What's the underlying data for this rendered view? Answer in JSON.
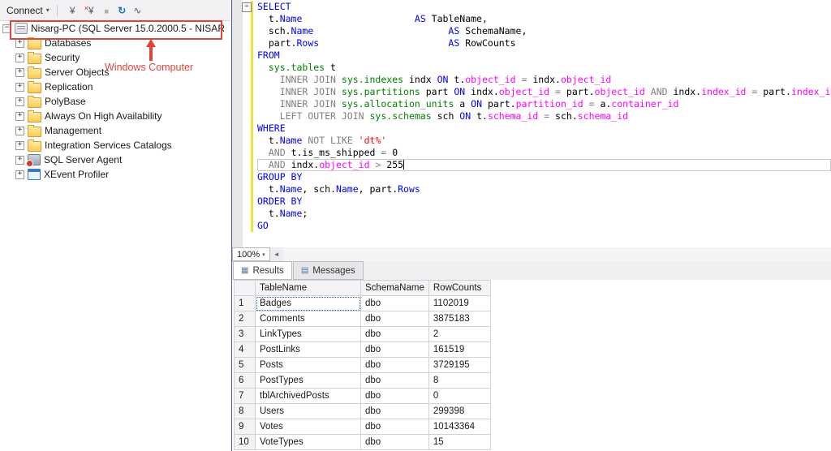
{
  "colors": {
    "keyword": "#0000ff",
    "operator": "#808080",
    "system_table": "#008000",
    "system_column": "#ff00ff",
    "string": "#ff0000",
    "text": "#000000",
    "annotation": "#e0443a",
    "refresh": "#1a73c9"
  },
  "object_explorer": {
    "toolbar": {
      "connect_label": "Connect",
      "icons": [
        {
          "name": "connect-icon",
          "glyph": "¥",
          "style": "connect"
        },
        {
          "name": "disconnect-icon",
          "glyph": "¥",
          "style": "disconnect"
        },
        {
          "name": "stop-icon",
          "glyph": "■",
          "style": "stop"
        },
        {
          "name": "refresh-icon",
          "glyph": "↻",
          "style": "refresh"
        },
        {
          "name": "activity-icon",
          "glyph": "∿",
          "style": "wave"
        }
      ]
    },
    "root_label": "Nisarg-PC (SQL Server 15.0.2000.5 - NISAR",
    "items": [
      {
        "label": "Databases",
        "icon": "folder"
      },
      {
        "label": "Security",
        "icon": "folder"
      },
      {
        "label": "Server Objects",
        "icon": "folder"
      },
      {
        "label": "Replication",
        "icon": "folder"
      },
      {
        "label": "PolyBase",
        "icon": "folder"
      },
      {
        "label": "Always On High Availability",
        "icon": "folder"
      },
      {
        "label": "Management",
        "icon": "folder"
      },
      {
        "label": "Integration Services Catalogs",
        "icon": "folder"
      },
      {
        "label": "SQL Server Agent",
        "icon": "agent"
      },
      {
        "label": "XEvent Profiler",
        "icon": "xevent"
      }
    ],
    "annotation": "Windows Computer"
  },
  "editor": {
    "zoom_level": "100%",
    "cursor_line_index": 13,
    "lines": [
      {
        "fold": true,
        "tokens": [
          [
            "k",
            "SELECT"
          ]
        ]
      },
      {
        "tokens": [
          [
            "d",
            "  t."
          ],
          [
            "k",
            "Name"
          ],
          [
            "d",
            "                    "
          ],
          [
            "k",
            "AS"
          ],
          [
            "d",
            " TableName,"
          ]
        ]
      },
      {
        "tokens": [
          [
            "d",
            "  sch."
          ],
          [
            "k",
            "Name"
          ],
          [
            "d",
            "                        "
          ],
          [
            "k",
            "AS"
          ],
          [
            "d",
            " SchemaName,"
          ]
        ]
      },
      {
        "tokens": [
          [
            "d",
            "  part."
          ],
          [
            "k",
            "Rows"
          ],
          [
            "d",
            "                       "
          ],
          [
            "k",
            "AS"
          ],
          [
            "d",
            " RowCounts"
          ]
        ]
      },
      {
        "tokens": [
          [
            "k",
            "FROM"
          ]
        ]
      },
      {
        "tokens": [
          [
            "d",
            "  "
          ],
          [
            "s",
            "sys.tables"
          ],
          [
            "d",
            " t"
          ]
        ]
      },
      {
        "tokens": [
          [
            "d",
            "    "
          ],
          [
            "g",
            "INNER JOIN"
          ],
          [
            "d",
            " "
          ],
          [
            "s",
            "sys.indexes"
          ],
          [
            "d",
            " indx "
          ],
          [
            "k",
            "ON"
          ],
          [
            "d",
            " t."
          ],
          [
            "m",
            "object_id"
          ],
          [
            "d",
            " "
          ],
          [
            "g",
            "="
          ],
          [
            "d",
            " indx."
          ],
          [
            "m",
            "object_id"
          ]
        ]
      },
      {
        "tokens": [
          [
            "d",
            "    "
          ],
          [
            "g",
            "INNER JOIN"
          ],
          [
            "d",
            " "
          ],
          [
            "s",
            "sys.partitions"
          ],
          [
            "d",
            " part "
          ],
          [
            "k",
            "ON"
          ],
          [
            "d",
            " indx."
          ],
          [
            "m",
            "object_id"
          ],
          [
            "d",
            " "
          ],
          [
            "g",
            "="
          ],
          [
            "d",
            " part."
          ],
          [
            "m",
            "object_id"
          ],
          [
            "d",
            " "
          ],
          [
            "g",
            "AND"
          ],
          [
            "d",
            " indx."
          ],
          [
            "m",
            "index_id"
          ],
          [
            "d",
            " "
          ],
          [
            "g",
            "="
          ],
          [
            "d",
            " part."
          ],
          [
            "m",
            "index_id"
          ]
        ]
      },
      {
        "tokens": [
          [
            "d",
            "    "
          ],
          [
            "g",
            "INNER JOIN"
          ],
          [
            "d",
            " "
          ],
          [
            "s",
            "sys.allocation_units"
          ],
          [
            "d",
            " a "
          ],
          [
            "k",
            "ON"
          ],
          [
            "d",
            " part."
          ],
          [
            "m",
            "partition_id"
          ],
          [
            "d",
            " "
          ],
          [
            "g",
            "="
          ],
          [
            "d",
            " a."
          ],
          [
            "m",
            "container_id"
          ]
        ]
      },
      {
        "tokens": [
          [
            "d",
            "    "
          ],
          [
            "g",
            "LEFT OUTER JOIN"
          ],
          [
            "d",
            " "
          ],
          [
            "s",
            "sys.schemas"
          ],
          [
            "d",
            " sch "
          ],
          [
            "k",
            "ON"
          ],
          [
            "d",
            " t."
          ],
          [
            "m",
            "schema_id"
          ],
          [
            "d",
            " "
          ],
          [
            "g",
            "="
          ],
          [
            "d",
            " sch."
          ],
          [
            "m",
            "schema_id"
          ]
        ]
      },
      {
        "tokens": [
          [
            "k",
            "WHERE"
          ]
        ]
      },
      {
        "tokens": [
          [
            "d",
            "  t."
          ],
          [
            "k",
            "Name"
          ],
          [
            "d",
            " "
          ],
          [
            "g",
            "NOT LIKE"
          ],
          [
            "d",
            " "
          ],
          [
            "r",
            "'dt%'"
          ]
        ]
      },
      {
        "tokens": [
          [
            "d",
            "  "
          ],
          [
            "g",
            "AND"
          ],
          [
            "d",
            " t.is_ms_shipped "
          ],
          [
            "g",
            "="
          ],
          [
            "d",
            " 0"
          ]
        ]
      },
      {
        "current": true,
        "tokens": [
          [
            "d",
            "  "
          ],
          [
            "g",
            "AND"
          ],
          [
            "d",
            " indx."
          ],
          [
            "m",
            "object_id"
          ],
          [
            "d",
            " "
          ],
          [
            "g",
            ">"
          ],
          [
            "d",
            " 255"
          ]
        ]
      },
      {
        "tokens": [
          [
            "k",
            "GROUP BY"
          ]
        ]
      },
      {
        "tokens": [
          [
            "d",
            "  t."
          ],
          [
            "k",
            "Name"
          ],
          [
            "d",
            ", sch."
          ],
          [
            "k",
            "Name"
          ],
          [
            "d",
            ", part."
          ],
          [
            "k",
            "Rows"
          ]
        ]
      },
      {
        "tokens": [
          [
            "k",
            "ORDER BY"
          ]
        ]
      },
      {
        "tokens": [
          [
            "d",
            "  t."
          ],
          [
            "k",
            "Name"
          ],
          [
            "d",
            ";"
          ]
        ]
      },
      {
        "tokens": [
          [
            "k",
            "GO"
          ]
        ]
      }
    ]
  },
  "results": {
    "tabs": [
      {
        "label": "Results",
        "icon": "grid"
      },
      {
        "label": "Messages",
        "icon": "messages"
      }
    ],
    "active_tab": "Results",
    "columns": [
      "TableName",
      "SchemaName",
      "RowCounts"
    ],
    "rows": [
      [
        "1",
        "Badges",
        "dbo",
        "1102019"
      ],
      [
        "2",
        "Comments",
        "dbo",
        "3875183"
      ],
      [
        "3",
        "LinkTypes",
        "dbo",
        "2"
      ],
      [
        "4",
        "PostLinks",
        "dbo",
        "161519"
      ],
      [
        "5",
        "Posts",
        "dbo",
        "3729195"
      ],
      [
        "6",
        "PostTypes",
        "dbo",
        "8"
      ],
      [
        "7",
        "tblArchivedPosts",
        "dbo",
        "0"
      ],
      [
        "8",
        "Users",
        "dbo",
        "299398"
      ],
      [
        "9",
        "Votes",
        "dbo",
        "10143364"
      ],
      [
        "10",
        "VoteTypes",
        "dbo",
        "15"
      ]
    ]
  }
}
